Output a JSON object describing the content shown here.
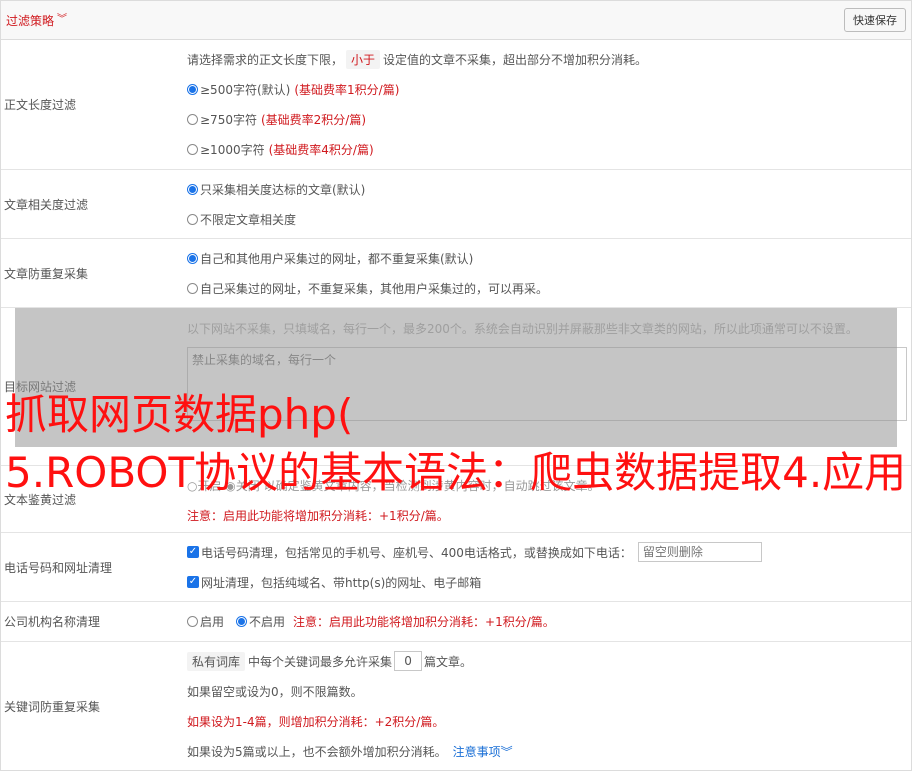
{
  "header": {
    "title": "过滤策略",
    "save_button": "快速保存"
  },
  "length_filter": {
    "label": "正文长度过滤",
    "desc_prefix": "请选择需求的正文长度下限，",
    "desc_tag": "小于",
    "desc_suffix": "设定值的文章不采集，超出部分不增加积分消耗。",
    "options": [
      {
        "text": "≥500字符(默认)",
        "note": "(基础费率1积分/篇)",
        "selected": true
      },
      {
        "text": "≥750字符",
        "note": "(基础费率2积分/篇)",
        "selected": false
      },
      {
        "text": "≥1000字符",
        "note": "(基础费率4积分/篇)",
        "selected": false
      }
    ]
  },
  "relevance_filter": {
    "label": "文章相关度过滤",
    "options": [
      {
        "text": "只采集相关度达标的文章(默认)",
        "selected": true
      },
      {
        "text": "不限定文章相关度",
        "selected": false
      }
    ]
  },
  "duplicate_filter": {
    "label": "文章防重复采集",
    "options": [
      {
        "text": "自己和其他用户采集过的网址，都不重复采集(默认)",
        "selected": true
      },
      {
        "text": "自己采集过的网址，不重复采集，其他用户采集过的，可以再采。",
        "selected": false
      }
    ]
  },
  "domain_filter": {
    "label": "目标网站过滤",
    "desc": "以下网站不采集，只填域名，每行一个，最多200个。系统会自动识别并屏蔽那些非文章类的网站，所以此项通常可以不设置。",
    "placeholder": "禁止采集的域名，每行一个"
  },
  "porn_filter": {
    "label": "文本鉴黄过滤",
    "line": "○开启 ◉关闭 以确定鉴黄文章内容，当检测到涉黄内容时，自动跳过该文章。",
    "note": "注意：启用此功能将增加积分消耗：+1积分/篇。"
  },
  "phone_cleanup": {
    "label": "电话号码和网址清理",
    "phone_text": "电话号码清理，包括常见的手机号、座机号、400电话格式，或替换成如下电话：",
    "phone_placeholder": "留空则删除",
    "url_text": "网址清理，包括纯域名、带http(s)的网址、电子邮箱"
  },
  "company_cleanup": {
    "label": "公司机构名称清理",
    "on_label": "启用",
    "off_label": "不启用",
    "note": "注意：启用此功能将增加积分消耗：+1积分/篇。"
  },
  "keyword_dup": {
    "label": "关键词防重复采集",
    "tag": "私有词库",
    "line1_middle": "中每个关键词最多允许采集",
    "count": "0",
    "line1_suffix": "篇文章。",
    "line2": "如果留空或设为0，则不限篇数。",
    "line3": "如果设为1-4篇，则增加积分消耗：+2积分/篇。",
    "line4": "如果设为5篇或以上，也不会额外增加积分消耗。",
    "more_link": "注意事项"
  },
  "watermark": {
    "line1": "抓取网页数据php(",
    "line2": "5.ROBOT协议的基本语法：爬虫数据提取4.应用"
  }
}
